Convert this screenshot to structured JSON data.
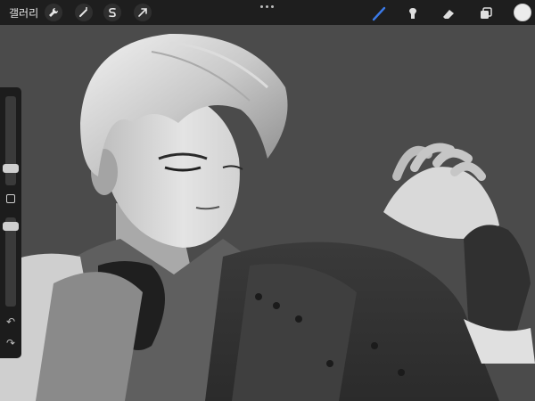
{
  "toolbar": {
    "gallery_label": "갤러리",
    "left_tools": [
      "wrench-icon",
      "magic-wand-icon",
      "selection-s-icon",
      "transform-arrow-icon"
    ],
    "right_tools": [
      "brush-icon",
      "smudge-icon",
      "eraser-icon",
      "layers-icon"
    ],
    "active_tool": "brush",
    "active_color": "#ececec",
    "brush_accent": "#3b7ae8"
  },
  "sidebar": {
    "brush_size_icon": "size-slider",
    "opacity_icon": "opacity-slider",
    "undo_glyph": "↶",
    "redo_glyph": "↷"
  },
  "canvas": {
    "background": "#4b4b4b"
  }
}
